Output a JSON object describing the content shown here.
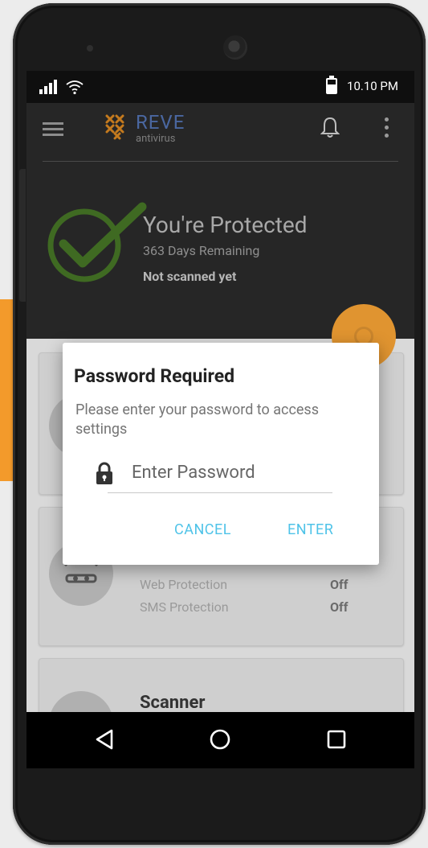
{
  "status_bar": {
    "time": "10.10 PM",
    "icons": [
      "signal-icon",
      "wifi-icon",
      "battery-icon"
    ]
  },
  "app_bar": {
    "brand": "REVE",
    "brand_sub": "antivirus",
    "icons": [
      "menu-icon",
      "bell-icon",
      "more-icon"
    ]
  },
  "hero": {
    "title": "You're Protected",
    "days_remaining": "363 Days Remaining",
    "scan_status": "Not scanned yet"
  },
  "cards": {
    "protection": {
      "rows": [
        {
          "label": "Web Protection",
          "value": "Off"
        },
        {
          "label": "SMS Protection",
          "value": "Off"
        }
      ]
    },
    "scanner": {
      "title": "Scanner"
    }
  },
  "dialog": {
    "title": "Password Required",
    "message": "Please enter your password to access settings",
    "input_placeholder": "Enter Password",
    "cancel_label": "CANCEL",
    "enter_label": "ENTER"
  },
  "colors": {
    "accent": "#4fc3e8",
    "brand": "#4a67a0",
    "fab": "#e09430",
    "check": "#3f6a22"
  }
}
